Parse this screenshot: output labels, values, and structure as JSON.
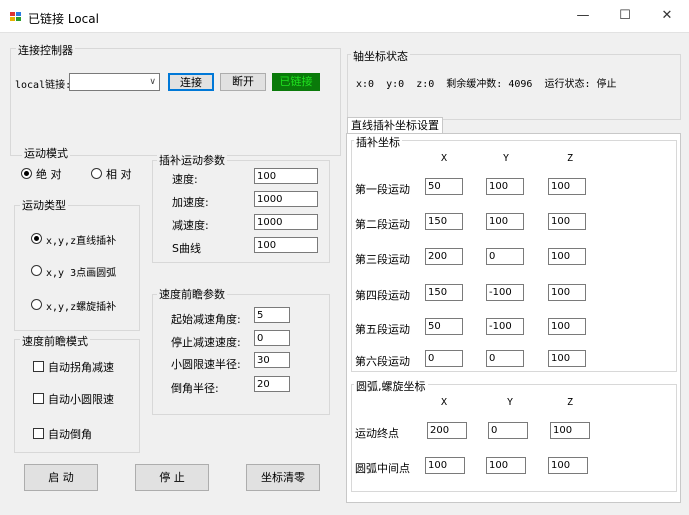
{
  "window": {
    "title": "已链接 Local",
    "min": "—",
    "max": "☐",
    "close": "✕"
  },
  "connect": {
    "title": "连接控制器",
    "label": "local链接:",
    "select_value": "",
    "btn_connect": "连接",
    "btn_disconnect": "断开",
    "status": "已链接",
    "status_color": "#0a7a0a"
  },
  "axis": {
    "title": "轴坐标状态",
    "text": "x:0  y:0  z:0  剩余缓冲数: 4096  运行状态: 停止"
  },
  "mode": {
    "title": "运动模式",
    "abs": "绝 对",
    "rel": "相 对"
  },
  "mtype": {
    "title": "运动类型",
    "opt1": "x,y,z直线插补",
    "opt2": "x,y 3点画圆弧",
    "opt3": "x,y,z螺旋插补"
  },
  "lookahead_mode": {
    "title": "速度前瞻模式",
    "opt1": "自动拐角减速",
    "opt2": "自动小圆限速",
    "opt3": "自动倒角"
  },
  "interp": {
    "title": "插补运动参数",
    "speed_label": "速度:",
    "speed": "100",
    "accel_label": "加速度:",
    "accel": "1000",
    "decel_label": "减速度:",
    "decel": "1000",
    "scurve_label": "S曲线",
    "scurve": "100"
  },
  "lookahead": {
    "title": "速度前瞻参数",
    "angle_label": "起始减速角度:",
    "angle": "5",
    "stopspeed_label": "停止减速速度:",
    "stopspeed": "0",
    "radius_label": "小圆限速半径:",
    "radius": "30",
    "chamfer_label": "倒角半径:",
    "chamfer": "20"
  },
  "buttons": {
    "start": "启 动",
    "stop": "停 止",
    "zero": "坐标清零"
  },
  "linear": {
    "tab": "直线插补坐标设置",
    "title": "插补坐标",
    "hx": "X",
    "hy": "Y",
    "hz": "Z",
    "rows": [
      {
        "label": "第一段运动",
        "x": "50",
        "y": "100",
        "z": "100"
      },
      {
        "label": "第二段运动",
        "x": "150",
        "y": "100",
        "z": "100"
      },
      {
        "label": "第三段运动",
        "x": "200",
        "y": "0",
        "z": "100"
      },
      {
        "label": "第四段运动",
        "x": "150",
        "y": "-100",
        "z": "100"
      },
      {
        "label": "第五段运动",
        "x": "50",
        "y": "-100",
        "z": "100"
      },
      {
        "label": "第六段运动",
        "x": "0",
        "y": "0",
        "z": "100"
      }
    ]
  },
  "arc": {
    "title": "圆弧,螺旋坐标",
    "hx": "X",
    "hy": "Y",
    "hz": "Z",
    "rows": [
      {
        "label": "运动终点",
        "x": "200",
        "y": "0",
        "z": "100"
      },
      {
        "label": "圆弧中间点",
        "x": "100",
        "y": "100",
        "z": "100"
      }
    ]
  }
}
